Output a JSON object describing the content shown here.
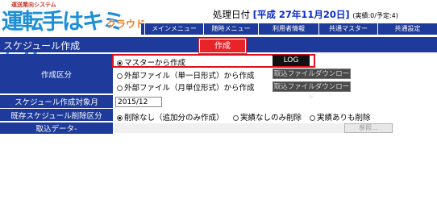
{
  "logo": {
    "subtitle": "運送業向システム",
    "name": "運転手はキミだ!!",
    "cloud": "クラウド"
  },
  "header": {
    "date_label": "処理日付",
    "date_value": "[平成 27年11月20日]",
    "date_note": "(実績:0/予定:4)"
  },
  "menu": {
    "items": [
      {
        "label": "メインメニュー"
      },
      {
        "label": "随時メニュー"
      },
      {
        "label": "利用者情報"
      },
      {
        "label": "共通マスター"
      },
      {
        "label": "共通設定"
      }
    ]
  },
  "page": {
    "title": "スケジュール作成",
    "create_button": "作成"
  },
  "form": {
    "creation_type": {
      "label": "作成区分",
      "options": [
        {
          "label": "マスターから作成",
          "selected": true
        },
        {
          "label": "外部ファイル（単一日形式）から作成",
          "selected": false
        },
        {
          "label": "外部ファイル（月単位形式）から作成",
          "selected": false
        }
      ],
      "log_button": "LOG",
      "download_button_1": "取込ファイルダウンロード",
      "download_button_2": "取込ファイルダウンロード"
    },
    "target_month": {
      "label": "スケジュール作成対象月",
      "value": "2015/12"
    },
    "delete_type": {
      "label": "既存スケジュール削除区分",
      "options": [
        {
          "label": "削除なし（追加分のみ作成）",
          "selected": true
        },
        {
          "label": "実績なしのみ削除",
          "selected": false
        },
        {
          "label": "実績ありも削除",
          "selected": false
        }
      ]
    },
    "import_data": {
      "label": "取込データ-",
      "browse_button": "参照..."
    }
  },
  "colors": {
    "navy": "#1e3a9a",
    "accent_red": "#e8242b",
    "date_blue": "#0a2ad0"
  }
}
